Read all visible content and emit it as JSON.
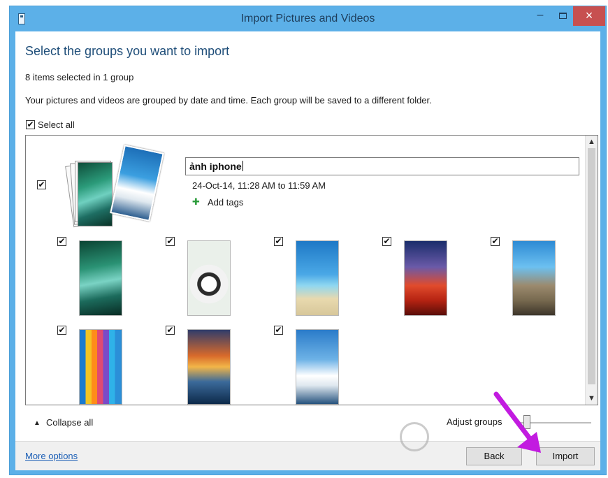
{
  "window": {
    "title": "Import Pictures and Videos",
    "controls": {
      "minimize": "–",
      "close": "×"
    }
  },
  "header": {
    "heading": "Select the groups you want to import",
    "summary": "8 items selected in 1 group",
    "description": "Your pictures and videos are grouped by date and time. Each group will be saved to a different folder."
  },
  "select_all": {
    "label": "Select all",
    "checked": true
  },
  "group": {
    "name_value": "ảnh iphone",
    "date_range": "24-Oct-14, 11:28 AM to 11:59 AM",
    "add_tags_label": "Add tags",
    "checked": true,
    "thumbnails": [
      {
        "id": "wave-green",
        "checked": true
      },
      {
        "id": "panda",
        "checked": true
      },
      {
        "id": "beach-palm",
        "checked": true
      },
      {
        "id": "sunset-bird",
        "checked": true
      },
      {
        "id": "city-canal",
        "checked": true
      },
      {
        "id": "color-pencils",
        "checked": true
      },
      {
        "id": "ocean-wave-sunset",
        "checked": true
      },
      {
        "id": "santorini",
        "checked": true
      }
    ]
  },
  "bottom": {
    "collapse_label": "Collapse all",
    "adjust_label": "Adjust groups"
  },
  "footer": {
    "more_options": "More options",
    "back_label": "Back",
    "import_label": "Import"
  },
  "colors": {
    "titlebar": "#5cb0e8",
    "close_button": "#c75050",
    "heading": "#1f4e79",
    "link": "#1c5fb6",
    "annotation_arrow": "#c21be0"
  },
  "icons": {
    "check": "✔",
    "scroll_up": "▲",
    "scroll_down": "▼",
    "collapse": "▲",
    "tag": "✚"
  }
}
